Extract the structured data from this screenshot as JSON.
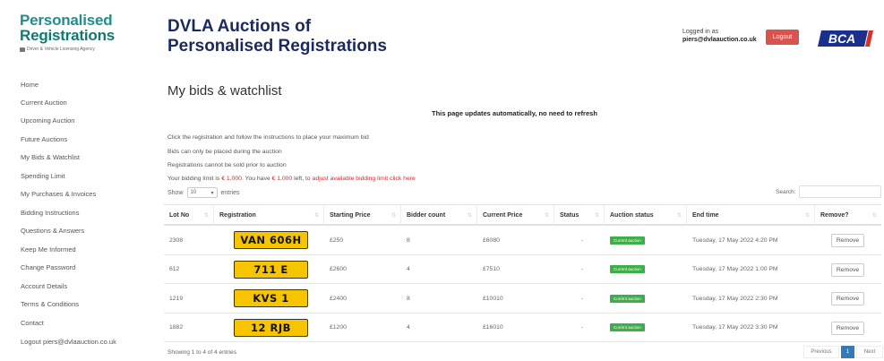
{
  "header": {
    "logo_line1": "Personalised",
    "logo_line2": "Registrations",
    "logo_sub": "Driver & Vehicle Licensing Agency",
    "title": "DVLA Auctions of Personalised Registrations",
    "logged_in_label": "Logged in as",
    "user_email": "piers@dvlaauction.co.uk",
    "logout_label": "Logout",
    "partner_logo": "BCA",
    "accent_color": "#d9534f"
  },
  "sidebar": {
    "items": [
      {
        "label": "Home"
      },
      {
        "label": "Current Auction"
      },
      {
        "label": "Upcoming Auction"
      },
      {
        "label": "Future Auctions"
      },
      {
        "label": "My Bids & Watchlist"
      },
      {
        "label": "Spending Limit"
      },
      {
        "label": "My Purchases & Invoices"
      },
      {
        "label": "Bidding Instructions"
      },
      {
        "label": "Questions & Answers"
      },
      {
        "label": "Keep Me Informed"
      },
      {
        "label": "Change Password"
      },
      {
        "label": "Account Details"
      },
      {
        "label": "Terms & Conditions"
      },
      {
        "label": "Contact"
      },
      {
        "label": "Logout piers@dvlaauction.co.uk"
      }
    ]
  },
  "main": {
    "title": "My bids & watchlist",
    "auto_note": "This page updates automatically, no need to refresh",
    "info_lines": [
      "Click the registration and follow the instructions to place your maximum bid",
      "Bids can only be placed during the auction",
      "Registrations cannot be sold prior to auction"
    ],
    "limit_prefix": "Your bidding limit is",
    "limit_value": "€ 1,000",
    "limit_mid": ". You have",
    "limit_left": "€ 1,000",
    "limit_suffix": "left,",
    "limit_link": "to adjust available bidding limit click here",
    "show_label": "Show",
    "show_value": "10",
    "entries_label": "entries",
    "search_label": "Search:"
  },
  "table": {
    "headers": [
      "Lot No",
      "Registration",
      "Starting Price",
      "Bidder count",
      "Current Price",
      "Status",
      "Auction status",
      "End time",
      "Remove?"
    ],
    "rows": [
      {
        "lot": "2308",
        "plate": "VAN 606H",
        "start": "£250",
        "bidders": "8",
        "current": "£6080",
        "status": "-",
        "auction_status": "Current auction",
        "end": "Tuesday, 17 May 2022 4:20 PM",
        "remove": "Remove"
      },
      {
        "lot": "612",
        "plate": "711 E",
        "start": "£2600",
        "bidders": "4",
        "current": "£7510",
        "status": "-",
        "auction_status": "Current auction",
        "end": "Tuesday, 17 May 2022 1:00 PM",
        "remove": "Remove"
      },
      {
        "lot": "1219",
        "plate": "KVS 1",
        "start": "£2400",
        "bidders": "8",
        "current": "£10010",
        "status": "-",
        "auction_status": "Current auction",
        "end": "Tuesday, 17 May 2022 2:30 PM",
        "remove": "Remove"
      },
      {
        "lot": "1882",
        "plate": "12 RJB",
        "start": "£1200",
        "bidders": "4",
        "current": "£16010",
        "status": "-",
        "auction_status": "Current auction",
        "end": "Tuesday, 17 May 2022 3:30 PM",
        "remove": "Remove"
      }
    ],
    "status_color": "#3fae49",
    "plate_color": "#f7c500"
  },
  "footer": {
    "showing": "Showing 1 to 4 of 4 entries",
    "prev": "Previous",
    "page": "1",
    "next": "Next"
  }
}
